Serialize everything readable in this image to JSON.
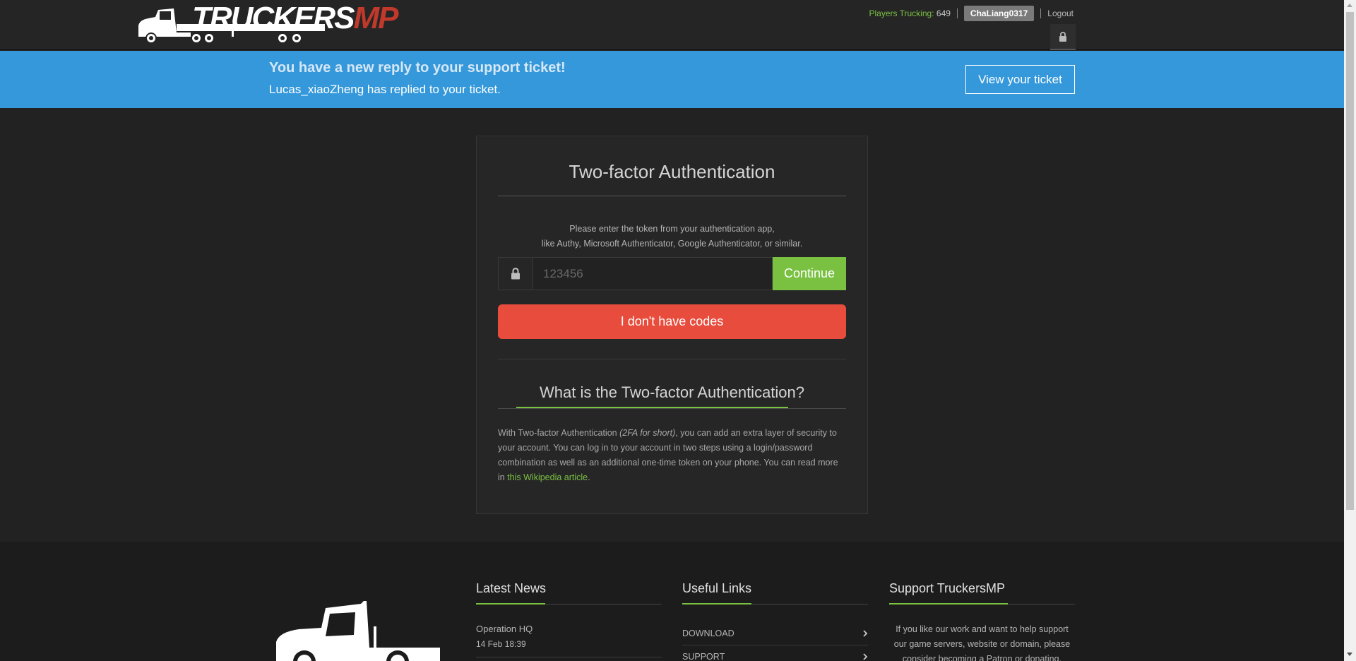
{
  "header": {
    "logo_text_white": "TRUCKERS",
    "logo_text_red": "MP",
    "players_label": "Players Trucking:",
    "players_count": "649",
    "username": "ChaLiang0317",
    "logout_label": "Logout"
  },
  "notification": {
    "title": "You have a new reply to your support ticket!",
    "message": "Lucas_xiaoZheng has replied to your ticket.",
    "button_label": "View your ticket"
  },
  "twofa": {
    "title": "Two-factor Authentication",
    "instructions_line1": "Please enter the token from your authentication app,",
    "instructions_line2": "like Authy, Microsoft Authenticator, Google Authenticator, or similar.",
    "token_placeholder": "123456",
    "token_value": "",
    "continue_label": "Continue",
    "no_codes_label": "I don't have codes",
    "what_title": "What is the Two-factor Authentication?",
    "desc_part1": "With Two-factor Authentication ",
    "desc_em": "(2FA for short)",
    "desc_part2": ", you can add an extra layer of security to your account. You can log in to your account in two steps using a login/password combination as well as an additional one-time token on your phone. You can read more in ",
    "desc_link": "this Wikipedia article",
    "desc_end": "."
  },
  "footer": {
    "news_title": "Latest News",
    "news_items": [
      {
        "title": "Operation HQ",
        "date": "14 Feb 18:39"
      }
    ],
    "links_title": "Useful Links",
    "links": [
      {
        "label": "DOWNLOAD"
      },
      {
        "label": "SUPPORT"
      }
    ],
    "support_title": "Support TruckersMP",
    "support_text": "If you like our work and want to help support our game servers, website or domain, please consider becoming a Patron or donating."
  },
  "colors": {
    "accent_green": "#7ac142",
    "banner_blue": "#3498db",
    "danger_red": "#e74c3c",
    "logo_red": "#c0392b"
  }
}
